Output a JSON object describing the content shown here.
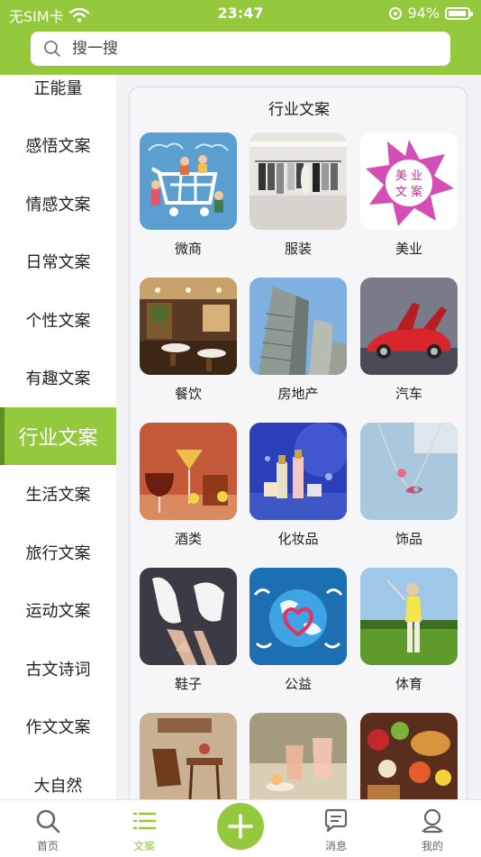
{
  "status_bar": {
    "carrier": "无SIM卡",
    "time": "23:47",
    "battery": "94%",
    "battery_level": 0.94
  },
  "search": {
    "placeholder": "搜一搜"
  },
  "sidebar": {
    "items": [
      {
        "label": "正能量"
      },
      {
        "label": "感悟文案"
      },
      {
        "label": "情感文案"
      },
      {
        "label": "日常文案"
      },
      {
        "label": "个性文案"
      },
      {
        "label": "有趣文案"
      },
      {
        "label": "行业文案",
        "active": true
      },
      {
        "label": "生活文案"
      },
      {
        "label": "旅行文案"
      },
      {
        "label": "运动文案"
      },
      {
        "label": "古文诗词"
      },
      {
        "label": "作文文案"
      },
      {
        "label": "大自然"
      }
    ]
  },
  "panel": {
    "title": "行业文案",
    "items": [
      {
        "label": "微商",
        "image": "shopping-cart-illustration"
      },
      {
        "label": "服装",
        "image": "clothing-store-photo"
      },
      {
        "label": "美业",
        "image": "beauty-logo",
        "logo_text": "美业文案"
      },
      {
        "label": "餐饮",
        "image": "restaurant-photo"
      },
      {
        "label": "房地产",
        "image": "buildings-photo"
      },
      {
        "label": "汽车",
        "image": "sports-car-photo"
      },
      {
        "label": "酒类",
        "image": "wine-glasses-photo"
      },
      {
        "label": "化妆品",
        "image": "cosmetics-photo"
      },
      {
        "label": "饰品",
        "image": "necklace-photo"
      },
      {
        "label": "鞋子",
        "image": "sneakers-photo"
      },
      {
        "label": "公益",
        "image": "globe-heart-illustration"
      },
      {
        "label": "体育",
        "image": "golf-photo"
      },
      {
        "label": "",
        "image": "chair-photo"
      },
      {
        "label": "",
        "image": "drinks-photo"
      },
      {
        "label": "",
        "image": "food-photo"
      }
    ]
  },
  "tabbar": {
    "tabs": [
      {
        "label": "首页",
        "icon": "search-icon"
      },
      {
        "label": "文案",
        "icon": "list-icon",
        "active": true
      },
      {
        "label": "",
        "icon": "plus-icon"
      },
      {
        "label": "消息",
        "icon": "message-icon"
      },
      {
        "label": "我的",
        "icon": "profile-icon"
      }
    ]
  },
  "colors": {
    "accent": "#94c93d",
    "accent_dark": "#5b8f1f"
  }
}
